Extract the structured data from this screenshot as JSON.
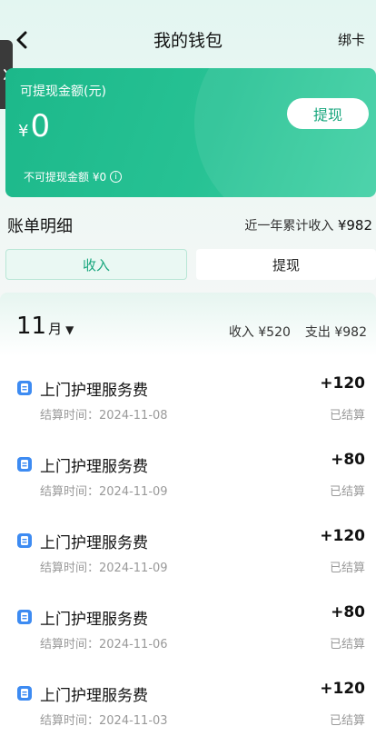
{
  "header": {
    "title": "我的钱包",
    "right_action": "绑卡"
  },
  "wallet": {
    "withdrawable_label": "可提现金额(元)",
    "currency": "¥",
    "amount": "0",
    "withdraw_button": "提现",
    "non_withdrawable": "不可提现金额 ¥0",
    "info_glyph": "i",
    "colors": {
      "card_start": "#1cb88a",
      "card_end": "#3fd0a4",
      "accent": "#17a67d"
    }
  },
  "bill": {
    "title": "账单明细",
    "year_total_label": "近一年累计收入",
    "year_total_amount": "¥982",
    "tabs": [
      {
        "label": "收入",
        "active": true
      },
      {
        "label": "提现",
        "active": false
      }
    ]
  },
  "month": {
    "number": "11",
    "unit": "月",
    "caret": "▼",
    "income": "收入 ¥520",
    "expense": "支出 ¥982"
  },
  "items": [
    {
      "name": "上门护理服务费",
      "time": "结算时间：2024-11-08",
      "amount": "+120",
      "status": "已结算"
    },
    {
      "name": "上门护理服务费",
      "time": "结算时间：2024-11-09",
      "amount": "+80",
      "status": "已结算"
    },
    {
      "name": "上门护理服务费",
      "time": "结算时间：2024-11-09",
      "amount": "+120",
      "status": "已结算"
    },
    {
      "name": "上门护理服务费",
      "time": "结算时间：2024-11-06",
      "amount": "+80",
      "status": "已结算"
    },
    {
      "name": "上门护理服务费",
      "time": "结算时间：2024-11-03",
      "amount": "+120",
      "status": "已结算"
    }
  ],
  "icons": {
    "back": "chevron-left-icon",
    "side_tab": "chevron-right-icon",
    "item": "receipt-icon"
  }
}
